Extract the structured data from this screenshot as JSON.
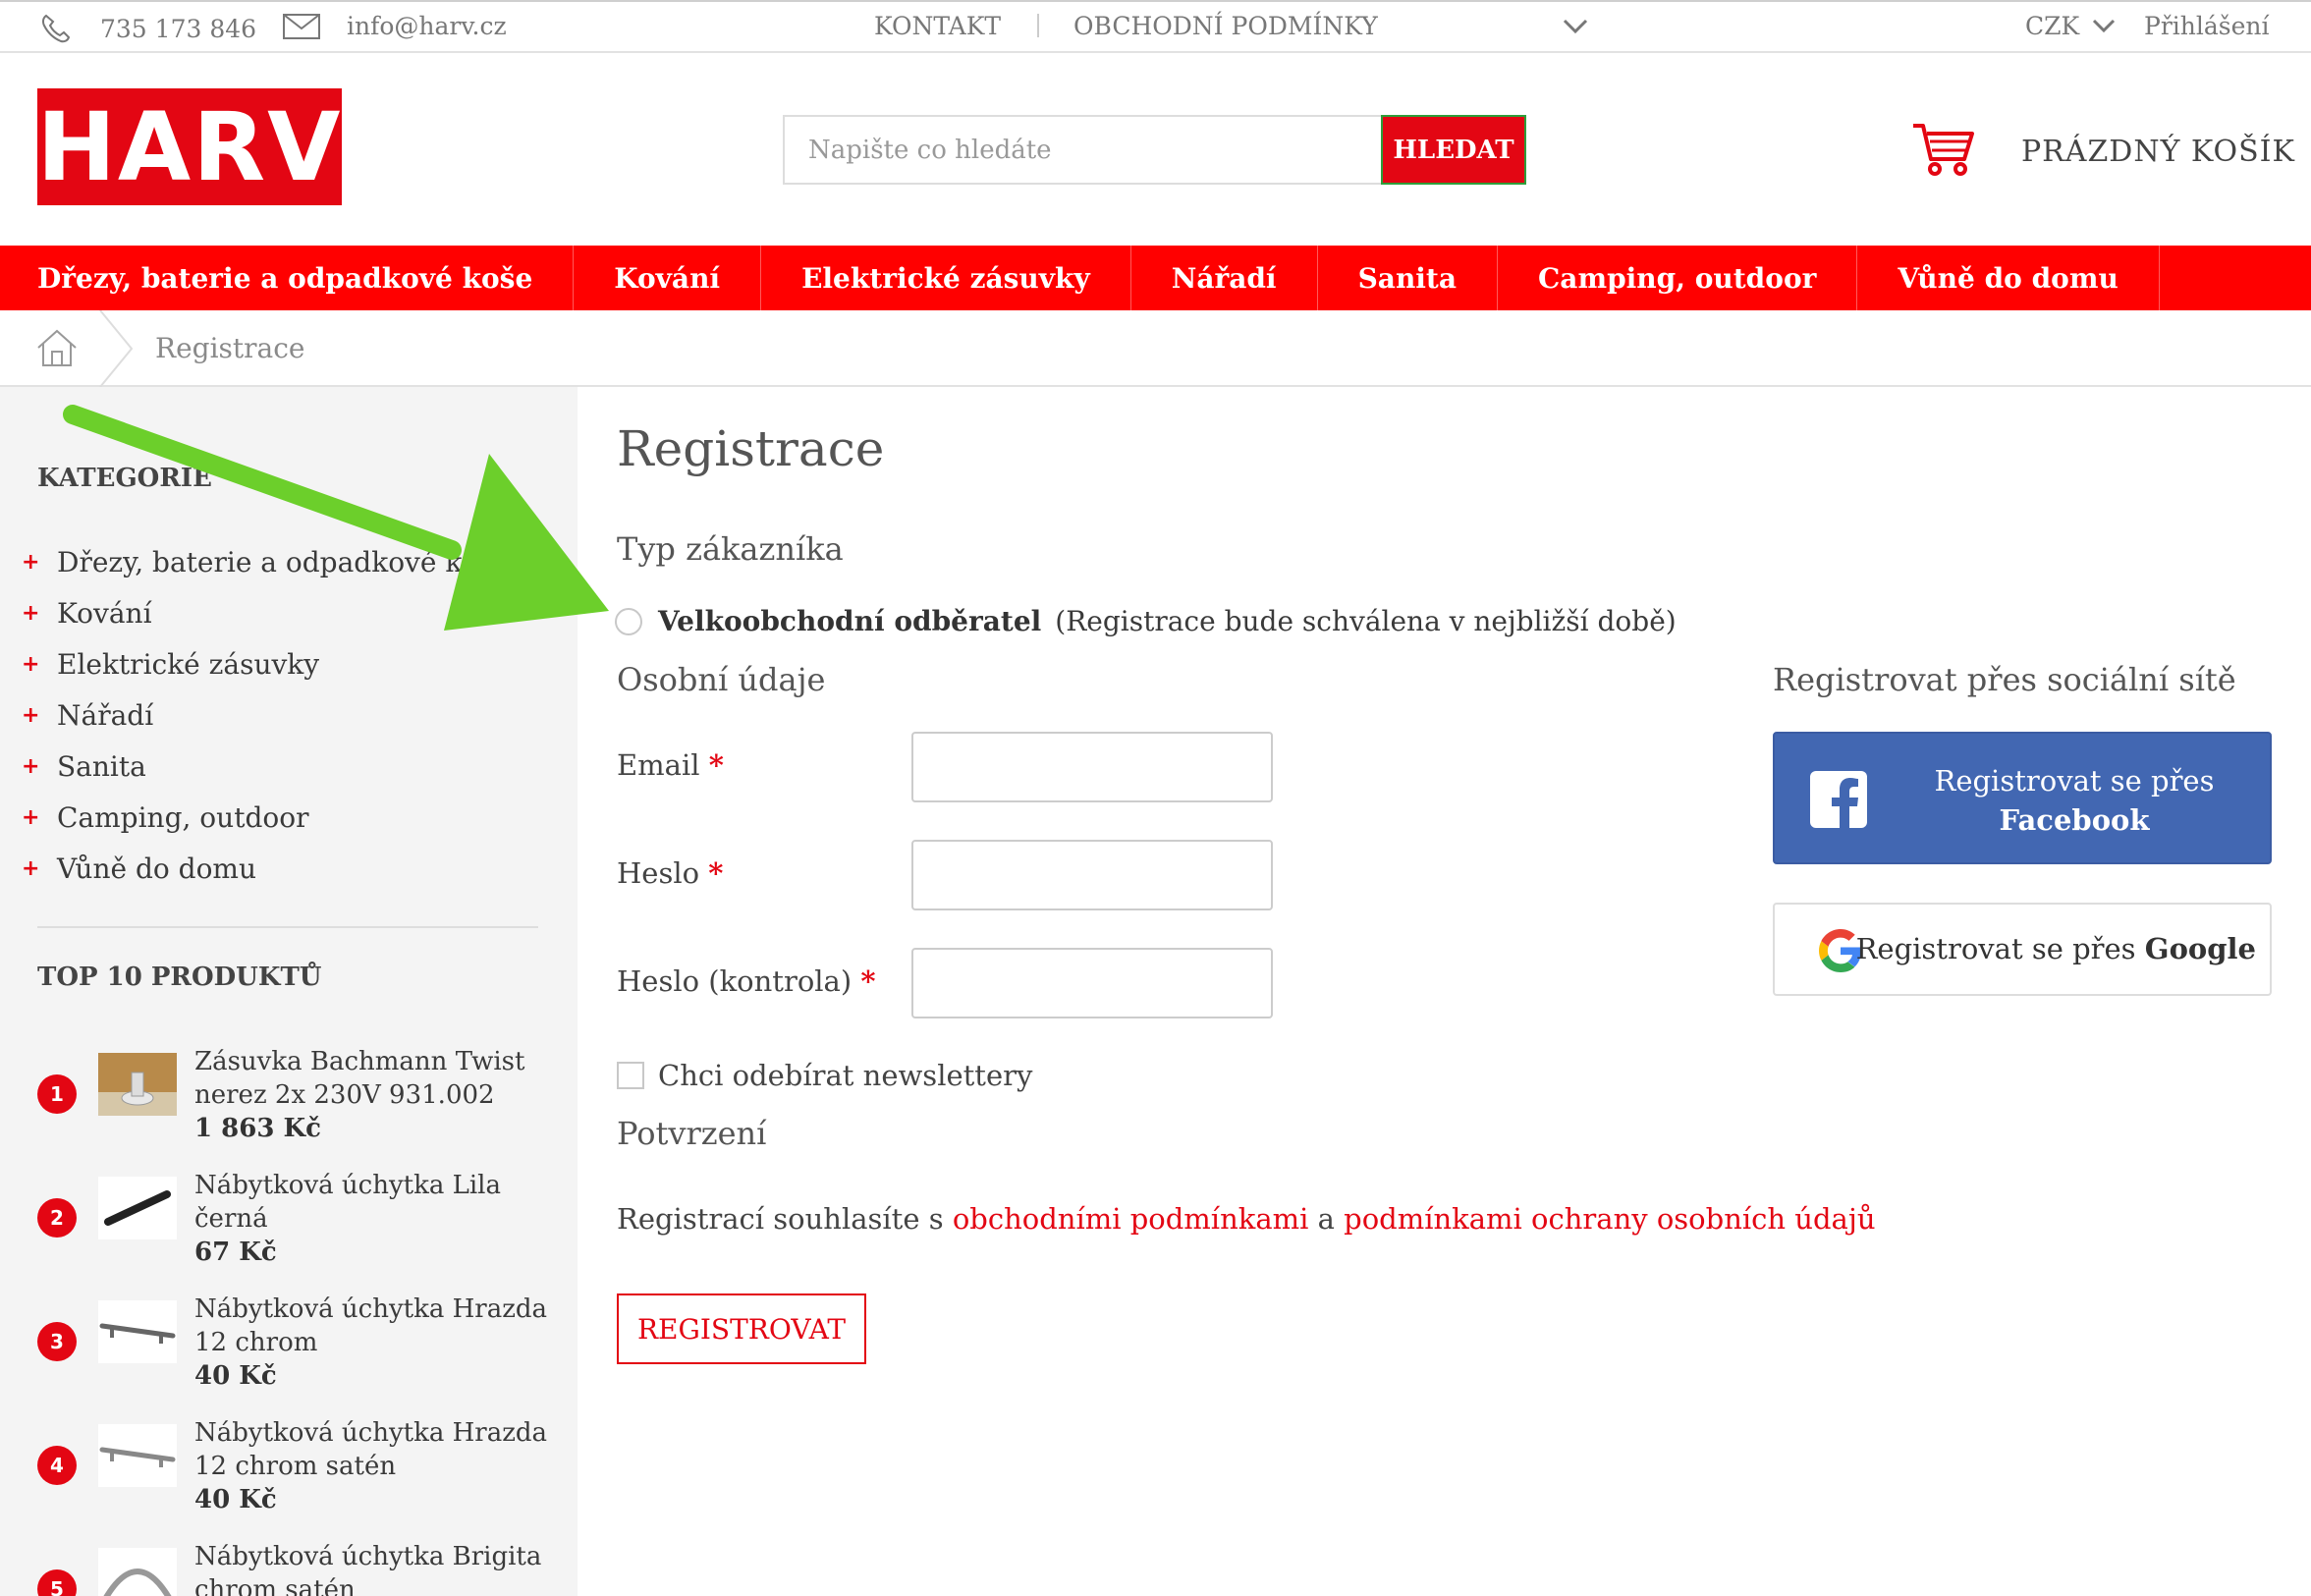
{
  "topbar": {
    "phone": "735 173 846",
    "email": "info@harv.cz",
    "links": [
      "KONTAKT",
      "OBCHODNÍ PODMÍNKY"
    ],
    "currency": "CZK",
    "login": "Přihlášení"
  },
  "header": {
    "logo": "HARV",
    "search_placeholder": "Napište co hledáte",
    "search_button": "HLEDAT",
    "cart_label": "PRÁZDNÝ KOŠÍK"
  },
  "nav": [
    "Dřezy, baterie a odpadkové koše",
    "Kování",
    "Elektrické zásuvky",
    "Nářadí",
    "Sanita",
    "Camping, outdoor",
    "Vůně do domu"
  ],
  "breadcrumb": {
    "current": "Registrace"
  },
  "sidebar": {
    "categories_title": "KATEGORIE",
    "categories": [
      "Dřezy, baterie a odpadkové koše",
      "Kování",
      "Elektrické zásuvky",
      "Nářadí",
      "Sanita",
      "Camping, outdoor",
      "Vůně do domu"
    ],
    "top_title": "TOP 10 PRODUKTŮ",
    "top_products": [
      {
        "num": "1",
        "name": "Zásuvka Bachmann Twist nerez 2x 230V 931.002",
        "price": "1 863 Kč"
      },
      {
        "num": "2",
        "name": "Nábytková úchytka Lila černá",
        "price": "67 Kč"
      },
      {
        "num": "3",
        "name": "Nábytková úchytka Hrazda 12 chrom",
        "price": "40 Kč"
      },
      {
        "num": "4",
        "name": "Nábytková úchytka Hrazda 12 chrom satén",
        "price": "40 Kč"
      },
      {
        "num": "5",
        "name": "Nábytková úchytka Brigita chrom satén",
        "price": ""
      }
    ]
  },
  "main": {
    "title": "Registrace",
    "customer_type_title": "Typ zákazníka",
    "radio_label": "Velkoobchodní odběratel",
    "radio_note": "(Registrace bude schválena v nejbližší době)",
    "personal_title": "Osobní údaje",
    "fields": {
      "email": "Email",
      "password": "Heslo",
      "password_check": "Heslo (kontrola)"
    },
    "required_mark": "*",
    "newsletter": "Chci odebírat newslettery",
    "confirm_title": "Potvrzení",
    "consent": {
      "prefix": "Registrací souhlasíte s",
      "link1": "obchodními podmínkami",
      "middle": "a",
      "link2": "podmínkami ochrany osobních údajů"
    },
    "submit": "REGISTROVAT"
  },
  "social": {
    "title": "Registrovat přes sociální sítě",
    "facebook_line1": "Registrovat se přes",
    "facebook_line2": "Facebook",
    "google_prefix": "Registrovat se přes",
    "google_name": "Google"
  },
  "colors": {
    "brand_red": "#e30613",
    "nav_red": "#ff0000",
    "facebook": "#4267b2",
    "arrow_green": "#6ccf2b"
  }
}
